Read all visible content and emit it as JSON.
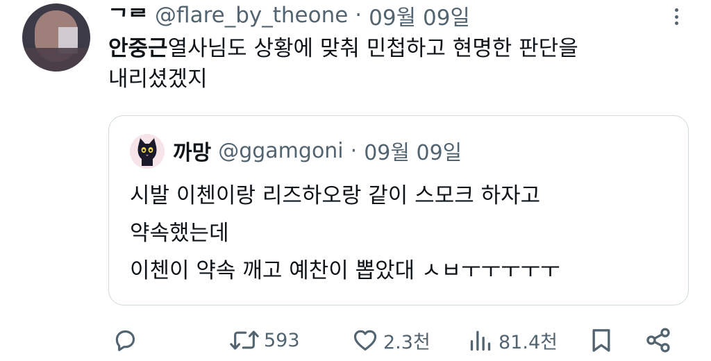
{
  "tweet": {
    "display_name": "ᄀᄅ",
    "handle": "@flare_by_theone",
    "separator": "·",
    "date": "09월 09일",
    "mention": "안중근",
    "text_line1": "열사님도 상황에 맞춰 민첩하고 현명한 판단을",
    "text_line2": "내리셨겠지"
  },
  "quote": {
    "display_name": "까망",
    "handle": "@ggamgoni",
    "separator": "·",
    "date": "09월 09일",
    "lines": [
      "시발 이첸이랑 리즈하오랑 같이 스모크 하자고",
      "약속했는데",
      "이첸이 약속 깨고 예찬이 뽑았대 ㅅㅂㅜㅜㅜㅜㅜ"
    ]
  },
  "actions": {
    "retweet_count": "593",
    "like_count": "2.3천",
    "view_count": "81.4천"
  },
  "colors": {
    "text": "#0f1419",
    "secondary": "#536471",
    "border": "#cfd9de"
  },
  "icons": [
    "reply-icon",
    "retweet-icon",
    "like-icon",
    "views-icon",
    "bookmark-icon",
    "share-icon",
    "more-icon"
  ]
}
